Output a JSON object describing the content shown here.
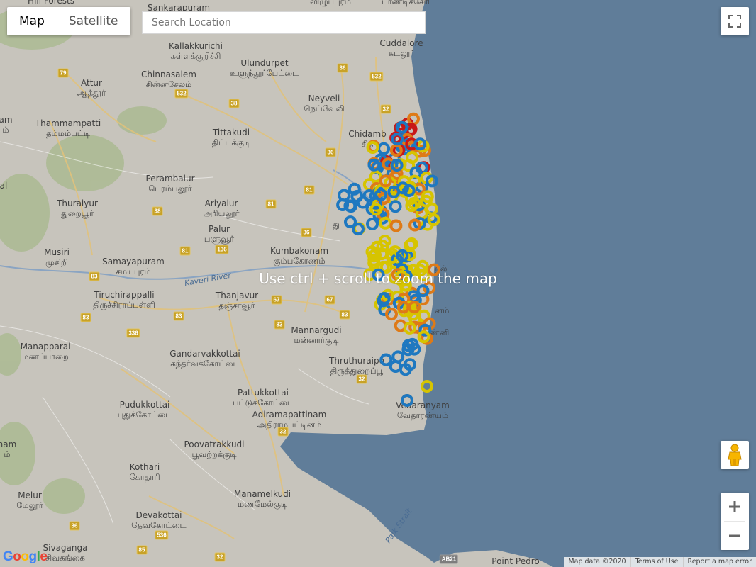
{
  "map_type_control": {
    "map_label": "Map",
    "satellite_label": "Satellite",
    "active": "Map"
  },
  "search": {
    "placeholder": "Search Location",
    "value": ""
  },
  "overlay_message": "Use ctrl + scroll to zoom the map",
  "attribution": {
    "map_data": "Map data ©2020",
    "terms": "Terms of Use",
    "report": "Report a map error"
  },
  "google_logo": "Google",
  "colors": {
    "land": "#c7c4bc",
    "sea": "#607d99",
    "marker_yellow": "#d6c400",
    "marker_blue": "#1e78c0",
    "marker_orange": "#de7a17",
    "marker_red": "#c81818"
  },
  "icons": {
    "fullscreen": "fullscreen-icon",
    "pegman": "pegman-icon",
    "zoom_in": "plus-icon",
    "zoom_out": "minus-icon"
  },
  "places": [
    {
      "en": "Hill Forests",
      "ta": ""
    },
    {
      "en": "Sankarapuram",
      "ta": ""
    },
    {
      "en": "",
      "ta": "விழுப்புரம்"
    },
    {
      "en": "",
      "ta": "பாண்டிச்சேரி"
    },
    {
      "en": "Kallakkurichi",
      "ta": "கள்ளக்குறிச்சி"
    },
    {
      "en": "Ulundurpet",
      "ta": "உளுந்தூர்பேட்டை"
    },
    {
      "en": "Cuddalore",
      "ta": "கடலூர்"
    },
    {
      "en": "Chinnasalem",
      "ta": "சின்னசேலம்"
    },
    {
      "en": "Attur",
      "ta": "ஆத்தூர்"
    },
    {
      "en": "Neyveli",
      "ta": "நெய்வேலி"
    },
    {
      "en": "Thammampatti",
      "ta": "தம்மம்பட்டி"
    },
    {
      "en": "am",
      "ta": "ம்"
    },
    {
      "en": "Tittakudi",
      "ta": "திட்டக்குடி"
    },
    {
      "en": "Chidamb",
      "ta": "சித"
    },
    {
      "en": "Perambalur",
      "ta": "பெரம்பலூர்"
    },
    {
      "en": "al",
      "ta": ""
    },
    {
      "en": "Thuraiyur",
      "ta": "துறையூர்"
    },
    {
      "en": "Ariyalur",
      "ta": "அரியலூர்"
    },
    {
      "en": "Palur",
      "ta": "பளுவூர்"
    },
    {
      "en": "Kumbakonam",
      "ta": "கும்பகோணம்"
    },
    {
      "en": "Musiri",
      "ta": "முசிறி"
    },
    {
      "en": "Samayapuram",
      "ta": "சமயபுரம்"
    },
    {
      "en": "Tiruchirappalli",
      "ta": "திருச்சிராப்பள்ளி"
    },
    {
      "en": "Thanjavur",
      "ta": "தஞ்சாவூர்"
    },
    {
      "en": "Mannargudi",
      "ta": "மன்னார்குடி"
    },
    {
      "en": "Manapparai",
      "ta": "மணப்பாறை"
    },
    {
      "en": "Gandarvakkottai",
      "ta": "கந்தர்வக்கோட்டை"
    },
    {
      "en": "Thruthuraipo",
      "ta": "திருத்துறைப்பூ"
    },
    {
      "en": "Pattukkottai",
      "ta": "பட்டுக்கோட்டை"
    },
    {
      "en": "Pudukkottai",
      "ta": "புதுக்கோட்டை"
    },
    {
      "en": "Adiramapattinam",
      "ta": "அதிராமபட்டினம்"
    },
    {
      "en": "Vedaranyam",
      "ta": "வேதாரண்யம்"
    },
    {
      "en": "ham",
      "ta": "ம்"
    },
    {
      "en": "Poovatrakkudi",
      "ta": "பூவற்றக்குடி"
    },
    {
      "en": "Kothari",
      "ta": "கோதாரி"
    },
    {
      "en": "Melur",
      "ta": "மேலூர்"
    },
    {
      "en": "Manamelkudi",
      "ta": "மணமேல்குடி"
    },
    {
      "en": "Devakottai",
      "ta": "தேவகோட்டை"
    },
    {
      "en": "Sivaganga",
      "ta": "சிவகங்கை"
    },
    {
      "en": "Point Pedro",
      "ta": ""
    }
  ],
  "coastal_fragments": [
    "நல்",
    "னம்",
    "ண்னி",
    "து"
  ],
  "water_labels": [
    "Kaveri River",
    "Palk Strait"
  ],
  "road_shields": [
    "79",
    "36",
    "532",
    "532",
    "38",
    "32",
    "36",
    "81",
    "38",
    "81",
    "36",
    "136",
    "81",
    "83",
    "67",
    "67",
    "83",
    "83",
    "336",
    "83",
    "83",
    "32",
    "32",
    "85",
    "32",
    "536",
    "36",
    "AB21"
  ]
}
